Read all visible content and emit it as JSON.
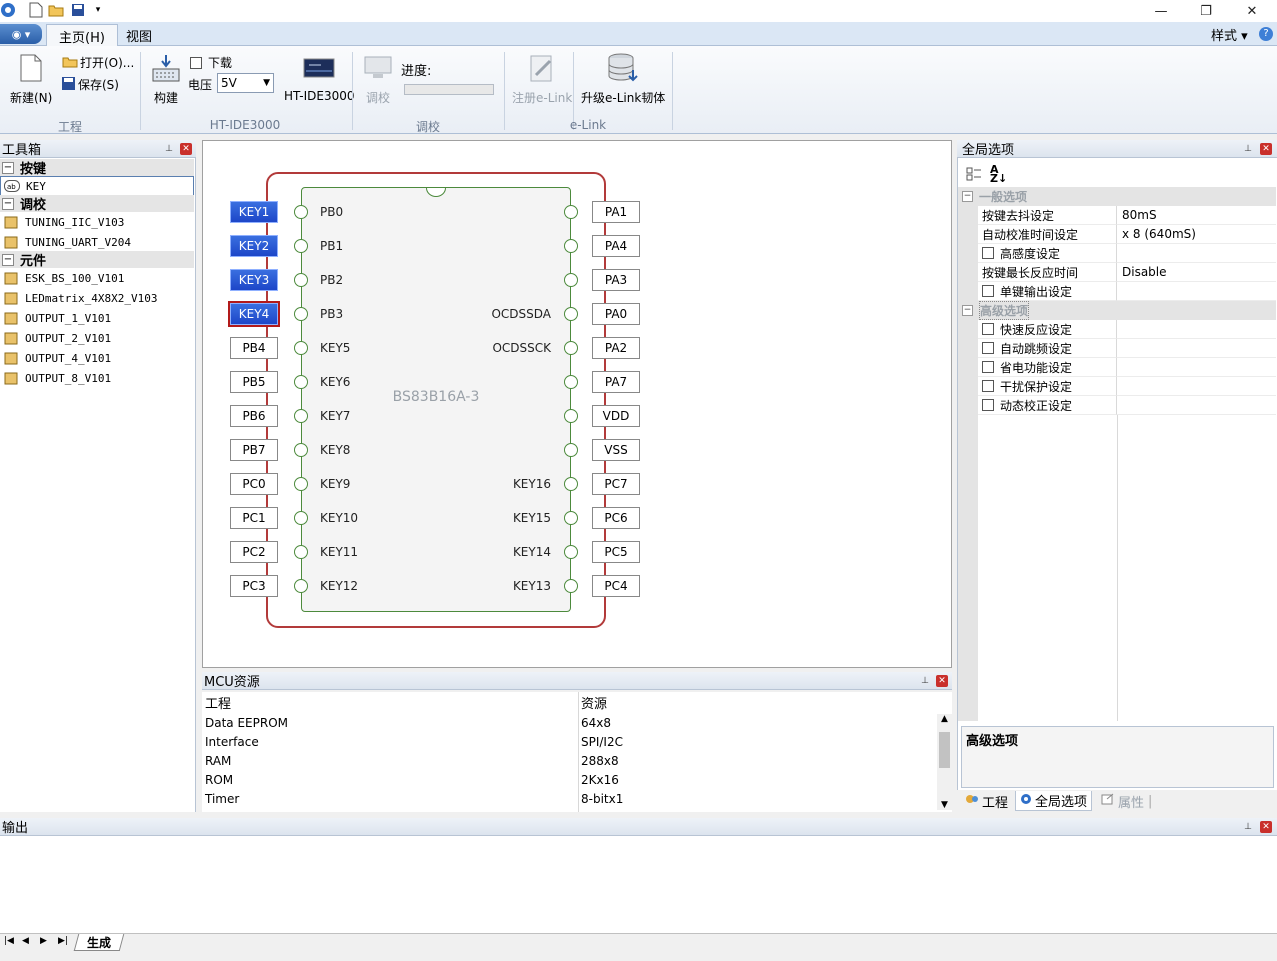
{
  "quick_access": {
    "new": "new-file-icon",
    "open": "open-folder-icon",
    "save": "save-icon"
  },
  "window_controls": {
    "minimize": "—",
    "restore": "❐",
    "close": "✕"
  },
  "ribbon_tabs": {
    "home": "主页(H)",
    "view": "视图"
  },
  "style_menu": "样式",
  "ribbon": {
    "new_label": "新建(N)",
    "open_label": "打开(O)...",
    "save_label": "保存(S)",
    "group_project": "工程",
    "build_label": "构建",
    "download_label": "下载",
    "voltage_label": "电压",
    "voltage_value": "5V",
    "ide_label": "HT-IDE3000",
    "group_ide": "HT-IDE3000",
    "tune_label": "调校",
    "progress_label": "进度:",
    "group_tune": "调校",
    "register_label": "注册e-Link",
    "upgrade_label": "升级e-Link韧体",
    "group_elink": "e-Link"
  },
  "toolbox": {
    "title": "工具箱",
    "cat_keys": "按键",
    "key_item": "KEY",
    "cat_tune": "调校",
    "tune_items": [
      "TUNING_IIC_V103",
      "TUNING_UART_V204"
    ],
    "cat_components": "元件",
    "component_items": [
      "ESK_BS_100_V101",
      "LEDmatrix_4X8X2_V103",
      "OUTPUT_1_V101",
      "OUTPUT_2_V101",
      "OUTPUT_4_V101",
      "OUTPUT_8_V101"
    ]
  },
  "chip": {
    "name": "BS83B16A-3",
    "left_boxes": [
      "KEY1",
      "KEY2",
      "KEY3",
      "KEY4",
      "PB4",
      "PB5",
      "PB6",
      "PB7",
      "PC0",
      "PC1",
      "PC2",
      "PC3"
    ],
    "left_pins": [
      "PB0",
      "PB1",
      "PB2",
      "PB3",
      "KEY5",
      "KEY6",
      "KEY7",
      "KEY8",
      "KEY9",
      "KEY10",
      "KEY11",
      "KEY12"
    ],
    "right_pins": [
      "",
      "",
      "",
      "OCDSSDA",
      "OCDSSCK",
      "",
      "",
      "",
      "KEY16",
      "KEY15",
      "KEY14",
      "KEY13"
    ],
    "right_boxes": [
      "PA1",
      "PA4",
      "PA3",
      "PA0",
      "PA2",
      "PA7",
      "VDD",
      "VSS",
      "PC7",
      "PC6",
      "PC5",
      "PC4"
    ]
  },
  "mcu": {
    "title": "MCU资源",
    "col1": "工程",
    "col2": "资源",
    "rows": [
      {
        "name": "Data EEPROM",
        "value": "64x8"
      },
      {
        "name": "Interface",
        "value": "SPI/I2C"
      },
      {
        "name": "RAM",
        "value": "288x8"
      },
      {
        "name": "ROM",
        "value": "2Kx16"
      },
      {
        "name": "Timer",
        "value": "8-bitx1"
      }
    ]
  },
  "props": {
    "title": "全局选项",
    "cat_general": "一般选项",
    "general": [
      {
        "name": "按键去抖设定",
        "value": "80mS",
        "checkbox": false
      },
      {
        "name": "自动校准时间设定",
        "value": "x 8 (640mS)",
        "checkbox": false
      },
      {
        "name": "高感度设定",
        "value": "",
        "checkbox": true
      },
      {
        "name": "按键最长反应时间",
        "value": "Disable",
        "checkbox": false
      },
      {
        "name": "单键输出设定",
        "value": "",
        "checkbox": true
      }
    ],
    "cat_advanced": "高级选项",
    "advanced": [
      {
        "name": "快速反应设定",
        "value": "",
        "checkbox": true
      },
      {
        "name": "自动跳频设定",
        "value": "",
        "checkbox": true
      },
      {
        "name": "省电功能设定",
        "value": "",
        "checkbox": true
      },
      {
        "name": "干扰保护设定",
        "value": "",
        "checkbox": true
      },
      {
        "name": "动态校正设定",
        "value": "",
        "checkbox": true
      }
    ],
    "description_title": "高级选项"
  },
  "bottom_tabs": {
    "project": "工程",
    "global": "全局选项",
    "attributes": "属性"
  },
  "output": {
    "title": "输出",
    "tab_build": "生成"
  }
}
